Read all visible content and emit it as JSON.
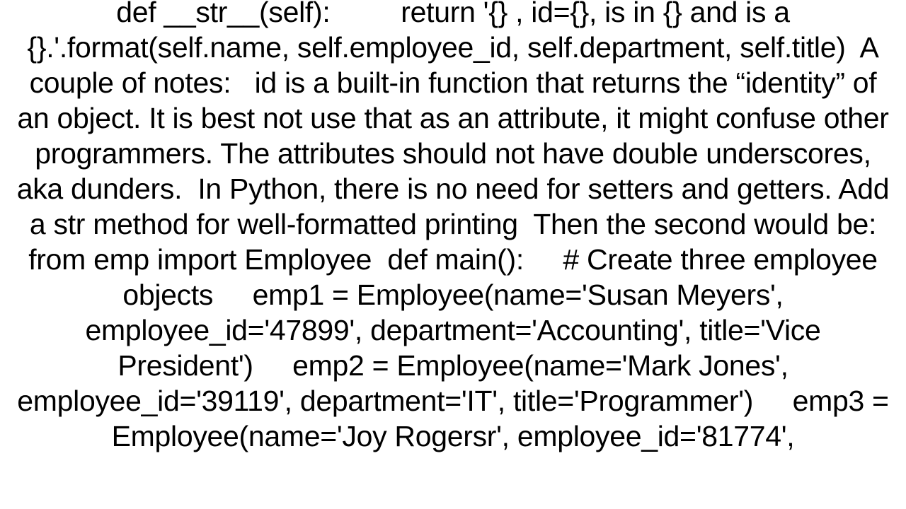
{
  "document": {
    "body_text": "def __str__(self):         return '{} , id={}, is in {} and is a {}.'.format(self.name, self.employee_id, self.department, self.title)  A couple of notes:   id is a built-in function that returns the “identity” of an object. It is best not use that as an attribute, it might confuse other programmers. The attributes should not have double underscores, aka dunders.  In Python, there is no need for setters and getters. Add a str method for well-formatted printing  Then the second would be: from emp import Employee  def main():     # Create three employee objects     emp1 = Employee(name='Susan Meyers', employee_id='47899', department='Accounting', title='Vice President')     emp2 = Employee(name='Mark Jones', employee_id='39119', department='IT', title='Programmer')     emp3 = Employee(name='Joy Rogersr', employee_id='81774',"
  }
}
